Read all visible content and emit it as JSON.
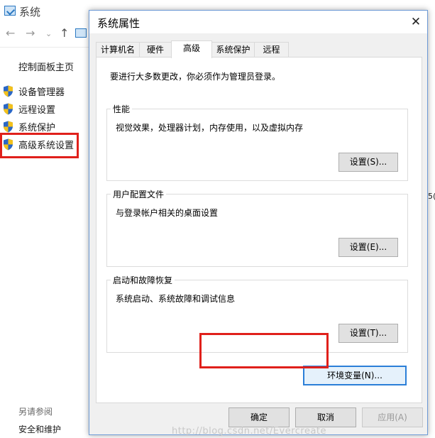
{
  "background_window": {
    "title": "系统",
    "nav": {
      "back": "←",
      "forward": "→",
      "dropdown": "⌄",
      "up": "↑"
    },
    "sidebar": {
      "home_link": "控制面板主页",
      "items": [
        {
          "label": "设备管理器",
          "icon": "uac-shield-icon"
        },
        {
          "label": "远程设置",
          "icon": "uac-shield-icon"
        },
        {
          "label": "系统保护",
          "icon": "uac-shield-icon"
        },
        {
          "label": "高级系统设置",
          "icon": "uac-shield-icon"
        }
      ],
      "see_also": "另请参阅",
      "security_link": "安全和维护"
    },
    "right_edge_text": "5("
  },
  "dialog": {
    "title": "系统属性",
    "close_glyph": "✕",
    "tabs": [
      {
        "label": "计算机名",
        "active": false
      },
      {
        "label": "硬件",
        "active": false
      },
      {
        "label": "高级",
        "active": true
      },
      {
        "label": "系统保护",
        "active": false
      },
      {
        "label": "远程",
        "active": false
      }
    ],
    "admin_note": "要进行大多数更改，你必须作为管理员登录。",
    "performance": {
      "legend": "性能",
      "description": "视觉效果，处理器计划，内存使用，以及虚拟内存",
      "button": "设置(S)..."
    },
    "user_profiles": {
      "legend": "用户配置文件",
      "description": "与登录帐户相关的桌面设置",
      "button": "设置(E)..."
    },
    "startup_recovery": {
      "legend": "启动和故障恢复",
      "description": "系统启动、系统故障和调试信息",
      "button": "设置(T)..."
    },
    "env_button": "环境变量(N)...",
    "ok_button": "确定",
    "cancel_button": "取消",
    "apply_button": "应用(A)"
  },
  "watermark": "http://blog.csdn.net/Evercreate",
  "colors": {
    "highlight": "#e0201b",
    "accent": "#2b7fd8",
    "dialog_bg": "#f0f0f0"
  }
}
